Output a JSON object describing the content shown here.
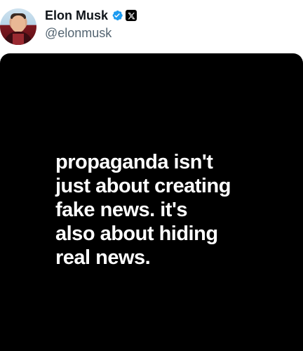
{
  "author": {
    "display_name": "Elon Musk",
    "handle": "@elonmusk",
    "verified_icon": "verified-badge-icon",
    "affiliation_icon": "x-logo-icon",
    "verified_color": "#1d9bf0"
  },
  "post": {
    "image_text": "propaganda isn't\njust about creating\nfake news. it's\nalso about hiding\nreal news."
  },
  "colors": {
    "background": "#ffffff",
    "media_background": "#000000",
    "text_on_media": "#ffffff",
    "handle_text": "#536471"
  }
}
